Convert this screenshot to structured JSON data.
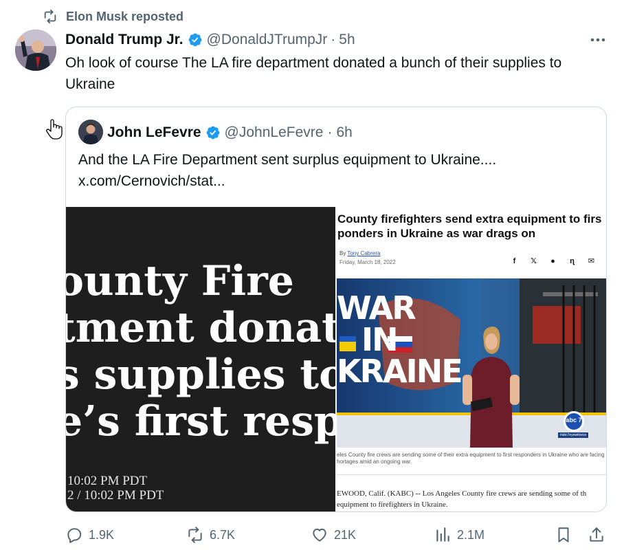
{
  "repost": {
    "icon": "repost-icon",
    "text": "Elon Musk reposted"
  },
  "post": {
    "author_name": "Donald Trump Jr.",
    "handle": "@DonaldJTrumpJr",
    "separator": "·",
    "time": "5h",
    "text": "Oh look of course The LA fire department donated a bunch of their supplies to Ukraine",
    "more_icon": "more-icon"
  },
  "quote": {
    "author_name": "John LeFevre",
    "handle": "@JohnLeFevre",
    "separator": "·",
    "time": "6h",
    "text_line1": "And the LA Fire Department sent surplus equipment to Ukraine....",
    "text_line2": "x.com/Cernovich/stat..."
  },
  "media_left": {
    "line1": "ounty Fire",
    "line2": "tment donatin",
    "line3": "s supplies to",
    "line4": "e’s first respo",
    "time1": "10:02 PM PDT",
    "time2": "2 / 10:02 PM PDT"
  },
  "media_right": {
    "title_line1": "County firefighters send extra equipment to firs",
    "title_line2": "ponders in Ukraine as war drags on",
    "byline_prefix": "By",
    "byline_author": "Tony Cabrera",
    "date": "Friday, March 18, 2022",
    "share_icons": [
      "f",
      "𝕏",
      "●",
      "ɳ",
      "✉"
    ],
    "video_words": [
      "WAR",
      "IN",
      "KRAINE"
    ],
    "channel_logo": "abc 7",
    "channel_tag": "#abc7eyewitness",
    "caption_line1": "eles County fire crews are sending some of their extra equipment to first responders in Ukraine who are facing",
    "caption_line2": "hortages amid an ongoing war.",
    "body_line1": "EWOOD, Calif. (KABC) -- Los Angeles County fire crews are sending some of th",
    "body_line2": "equipment to firefighters in Ukraine."
  },
  "actions": {
    "replies": "1.9K",
    "reposts": "6.7K",
    "likes": "21K",
    "views": "2.1M"
  },
  "colors": {
    "text": "#0f1419",
    "secondary": "#536471",
    "verified": "#1d9bf0",
    "border": "#cfd9de"
  }
}
